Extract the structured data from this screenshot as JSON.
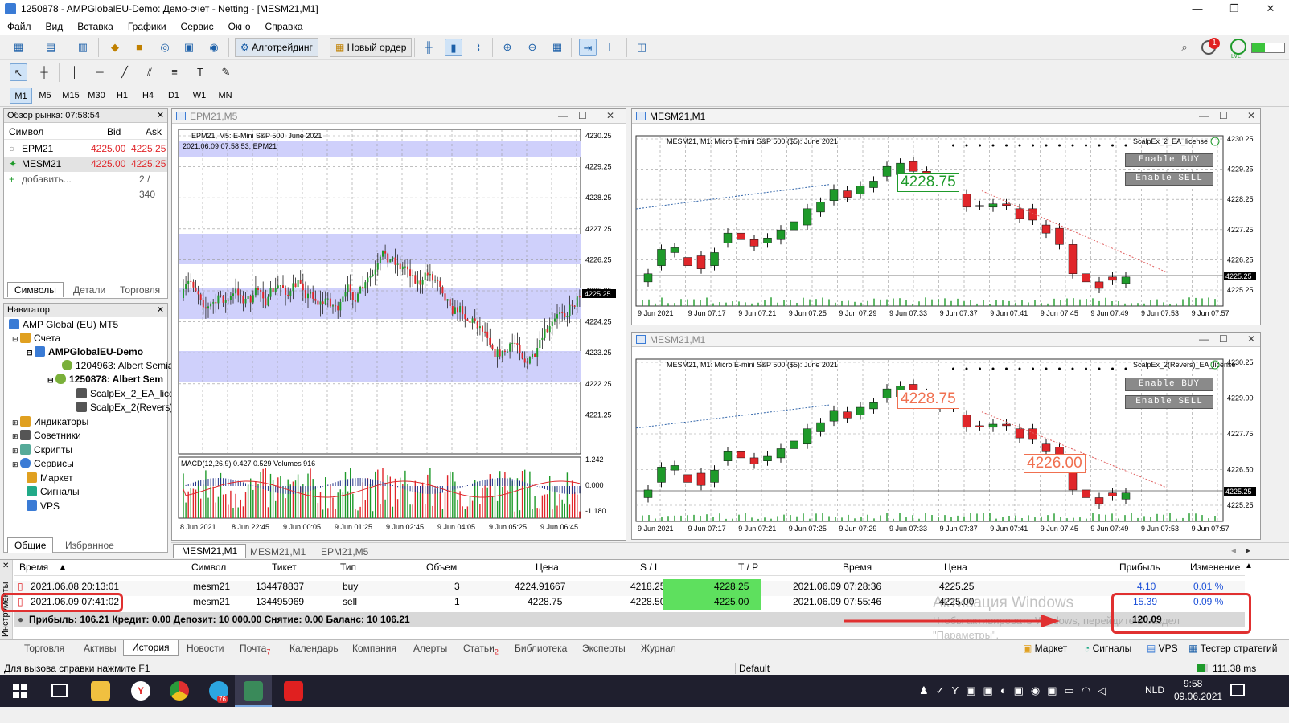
{
  "window": {
    "title": "1250878 - AMPGlobalEU-Demo: Демо-счет - Netting - [MESM21,M1]"
  },
  "menu": [
    "Файл",
    "Вид",
    "Вставка",
    "Графики",
    "Сервис",
    "Окно",
    "Справка"
  ],
  "toolbar": {
    "algo_label": "Алготрейдинг",
    "new_order_label": "Новый ордер",
    "notif_count": "1",
    "lvl_label": "LVL"
  },
  "timeframes": [
    "M1",
    "M5",
    "M15",
    "M30",
    "H1",
    "H4",
    "D1",
    "W1",
    "MN"
  ],
  "market_watch": {
    "title": "Обзор рынка: 07:58:54",
    "col_symbol": "Символ",
    "col_bid": "Bid",
    "col_ask": "Ask",
    "rows": [
      {
        "symbol": "EPM21",
        "bid": "4225.00",
        "ask": "4225.25"
      },
      {
        "symbol": "MESM21",
        "bid": "4225.00",
        "ask": "4225.25"
      }
    ],
    "add_label": "добавить...",
    "count": "2 / 340",
    "tabs": [
      "Символы",
      "Детали",
      "Торговля"
    ]
  },
  "navigator": {
    "title": "Навигатор",
    "items": [
      "AMP Global (EU) MT5",
      "Счета",
      "AMPGlobalEU-Demo",
      "1204963: Albert Semia",
      "1250878: Albert Sem",
      "ScalpEx_2_EA_licer",
      "ScalpEx_2(Revers)_",
      "Индикаторы",
      "Советники",
      "Скрипты",
      "Сервисы",
      "Маркет",
      "Сигналы",
      "VPS"
    ],
    "tabs": [
      "Общие",
      "Избранное"
    ]
  },
  "chart_epm": {
    "title": "EPM21,M5",
    "info1": "EPM21, M5:  E-Mini S&P 500: June 2021",
    "info2": "2021.06.09 07:58:53; EPM21",
    "price_labels": [
      "4230.25",
      "4229.25",
      "4228.25",
      "4227.25",
      "4226.25",
      "4225.25",
      "4224.25",
      "4223.25",
      "4222.25",
      "4221.25"
    ],
    "current": "4225.25",
    "macd_label": "MACD(12,26,9) 0.427 0.529 Volumes 916",
    "macd_labels": [
      "1.242",
      "0.000",
      "-1.180"
    ],
    "time_labels": [
      "8 Jun 2021",
      "8 Jun 22:45",
      "9 Jun 00:05",
      "9 Jun 01:25",
      "9 Jun 02:45",
      "9 Jun 04:05",
      "9 Jun 05:25",
      "9 Jun 06:45"
    ]
  },
  "chart_mes1": {
    "title": "MESM21,M1",
    "info": "MESM21, M1:  Micro E-mini S&P 500 ($5): June 2021",
    "ea": "ScalpEx_2_EA_license",
    "enable_buy": "Enable BUY",
    "enable_sell": "Enable SELL",
    "pricebox": "4228.75",
    "price_labels": [
      "4230.25",
      "4229.25",
      "4228.25",
      "4227.25",
      "4226.25",
      "4225.25"
    ],
    "current": "4225.25",
    "time_labels": [
      "9 Jun 2021",
      "9 Jun 07:17",
      "9 Jun 07:21",
      "9 Jun 07:25",
      "9 Jun 07:29",
      "9 Jun 07:33",
      "9 Jun 07:37",
      "9 Jun 07:41",
      "9 Jun 07:45",
      "9 Jun 07:49",
      "9 Jun 07:53",
      "9 Jun 07:57"
    ]
  },
  "chart_mes2": {
    "title": "MESM21,M1",
    "info": "MESM21, M1:  Micro E-mini S&P 500 ($5): June 2021",
    "ea": "ScalpEx_2(Revers)_EA_license",
    "enable_buy": "Enable BUY",
    "enable_sell": "Enable SELL",
    "pricebox1": "4228.75",
    "pricebox2": "4226.00",
    "price_labels": [
      "4230.25",
      "4229.00",
      "4227.75",
      "4226.50",
      "4225.25"
    ],
    "current": "4225.25",
    "time_labels": [
      "9 Jun 2021",
      "9 Jun 07:17",
      "9 Jun 07:21",
      "9 Jun 07:25",
      "9 Jun 07:29",
      "9 Jun 07:33",
      "9 Jun 07:37",
      "9 Jun 07:41",
      "9 Jun 07:45",
      "9 Jun 07:49",
      "9 Jun 07:53",
      "9 Jun 07:57"
    ]
  },
  "chart_tabs": [
    "MESM21,M1",
    "MESM21,M1",
    "EPM21,M5"
  ],
  "toolbox": {
    "side_label": "Инструменты",
    "headers": [
      "Время",
      "Символ",
      "Тикет",
      "Тип",
      "Объем",
      "Цена",
      "S / L",
      "T / P",
      "Время",
      "Цена",
      "Прибыль",
      "Изменение"
    ],
    "rows": [
      {
        "time": "2021.06.08 20:13:01",
        "symbol": "mesm21",
        "ticket": "134478837",
        "type": "buy",
        "volume": "3",
        "price": "4224.91667",
        "sl": "4218.25",
        "tp": "4228.25",
        "time2": "2021.06.09 07:28:36",
        "price2": "4225.25",
        "profit": "4.10",
        "change": "0.01 %"
      },
      {
        "time": "2021.06.09 07:41:02",
        "symbol": "mesm21",
        "ticket": "134495969",
        "type": "sell",
        "volume": "1",
        "price": "4228.75",
        "sl": "4228.50",
        "tp": "4225.00",
        "time2": "2021.06.09 07:55:46",
        "price2": "4225.00",
        "profit": "15.39",
        "change": "0.09 %"
      }
    ],
    "summary": "Прибыль: 106.21  Кредит: 0.00  Депозит: 10 000.00  Снятие: 0.00  Баланс: 10 106.21",
    "total": "120.09",
    "watermark1": "Активация Windows",
    "watermark2": "Чтобы активировать Windows, перейдите в раздел",
    "watermark3": "\"Параметры\"."
  },
  "bottom_tabs": [
    "Торговля",
    "Активы",
    "История",
    "Новости",
    "Почта",
    "Календарь",
    "Компания",
    "Алерты",
    "Статьи",
    "Библиотека",
    "Эксперты",
    "Журнал"
  ],
  "bottom_tab_badges": {
    "mail": "7",
    "articles": "2"
  },
  "bottom_right": [
    "Маркет",
    "Сигналы",
    "VPS",
    "Тестер стратегий"
  ],
  "status": {
    "help": "Для вызова справки нажмите F1",
    "profile": "Default",
    "ping": "111.38 ms"
  },
  "taskbar": {
    "time": "9:58",
    "date": "09.06.2021",
    "lang": "NLD",
    "telegram_badge": "76"
  },
  "colors": {
    "bull": "#1e9a2a",
    "bear": "#e0262a",
    "band": "#cfd0fb",
    "accent": "#1b5fa8"
  }
}
